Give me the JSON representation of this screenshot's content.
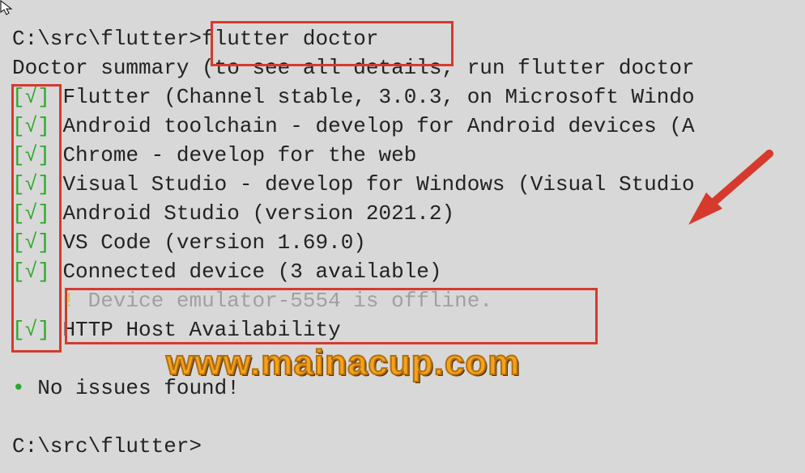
{
  "prompt_path": "C:\\src\\flutter>",
  "command": "flutter doctor",
  "summary_line": "Doctor summary (to see all details, run flutter doctor ",
  "checks": [
    {
      "mark": "√",
      "text": "Flutter (Channel stable, 3.0.3, on Microsoft Windo"
    },
    {
      "mark": "√",
      "text": "Android toolchain - develop for Android devices (A"
    },
    {
      "mark": "√",
      "text": "Chrome - develop for the web"
    },
    {
      "mark": "√",
      "text": "Visual Studio - develop for Windows (Visual Studio"
    },
    {
      "mark": "√",
      "text": "Android Studio (version 2021.2)"
    },
    {
      "mark": "√",
      "text": "VS Code (version 1.69.0)"
    },
    {
      "mark": "√",
      "text": "Connected device (3 available)"
    }
  ],
  "warning": {
    "bang": "!",
    "text": "Device emulator-5554 is offline."
  },
  "last_check": {
    "mark": "√",
    "text": "HTTP Host Availability"
  },
  "no_issues_bullet": "•",
  "no_issues": "No issues found!",
  "prompt2": "C:\\src\\flutter>",
  "watermark": "www.mainacup.com",
  "colors": {
    "annotation": "#d63a2e",
    "check": "#2aa82a",
    "watermark": "#f5a21c"
  }
}
